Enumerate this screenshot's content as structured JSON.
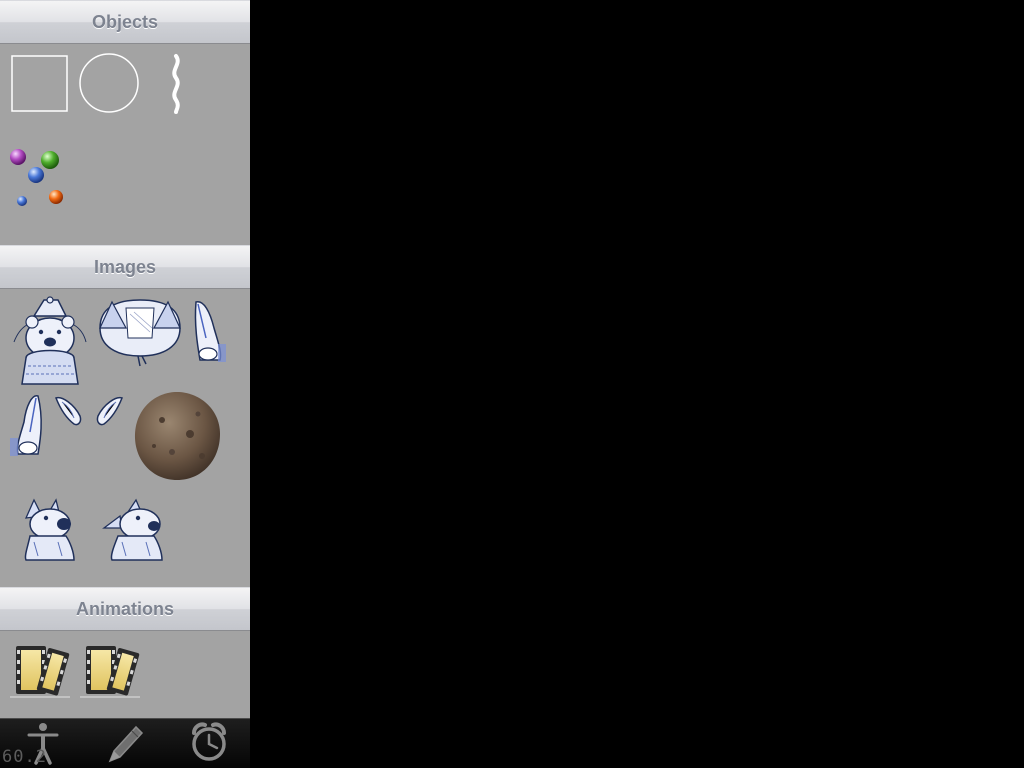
{
  "sections": {
    "objects": {
      "title": "Objects",
      "items": [
        "rectangle-shape",
        "circle-shape",
        "rope-shape",
        "balls-shape"
      ]
    },
    "images": {
      "title": "Images",
      "items": [
        "bear-with-hat",
        "bear-body",
        "bear-arm-right",
        "bear-arm-left",
        "bear-ears",
        "rock-ball",
        "bear-small-1",
        "bear-small-2"
      ]
    },
    "animations": {
      "title": "Animations",
      "items": [
        "film-animation-1",
        "film-animation-2"
      ]
    }
  },
  "toolbar": {
    "tools": [
      "accessibility-icon",
      "pencil-icon",
      "alarm-clock-icon"
    ]
  },
  "fps_counter": "60.2",
  "colors": {
    "panel": "#a3a3a3",
    "header_text": "#7d8390",
    "canvas": "#000000"
  }
}
